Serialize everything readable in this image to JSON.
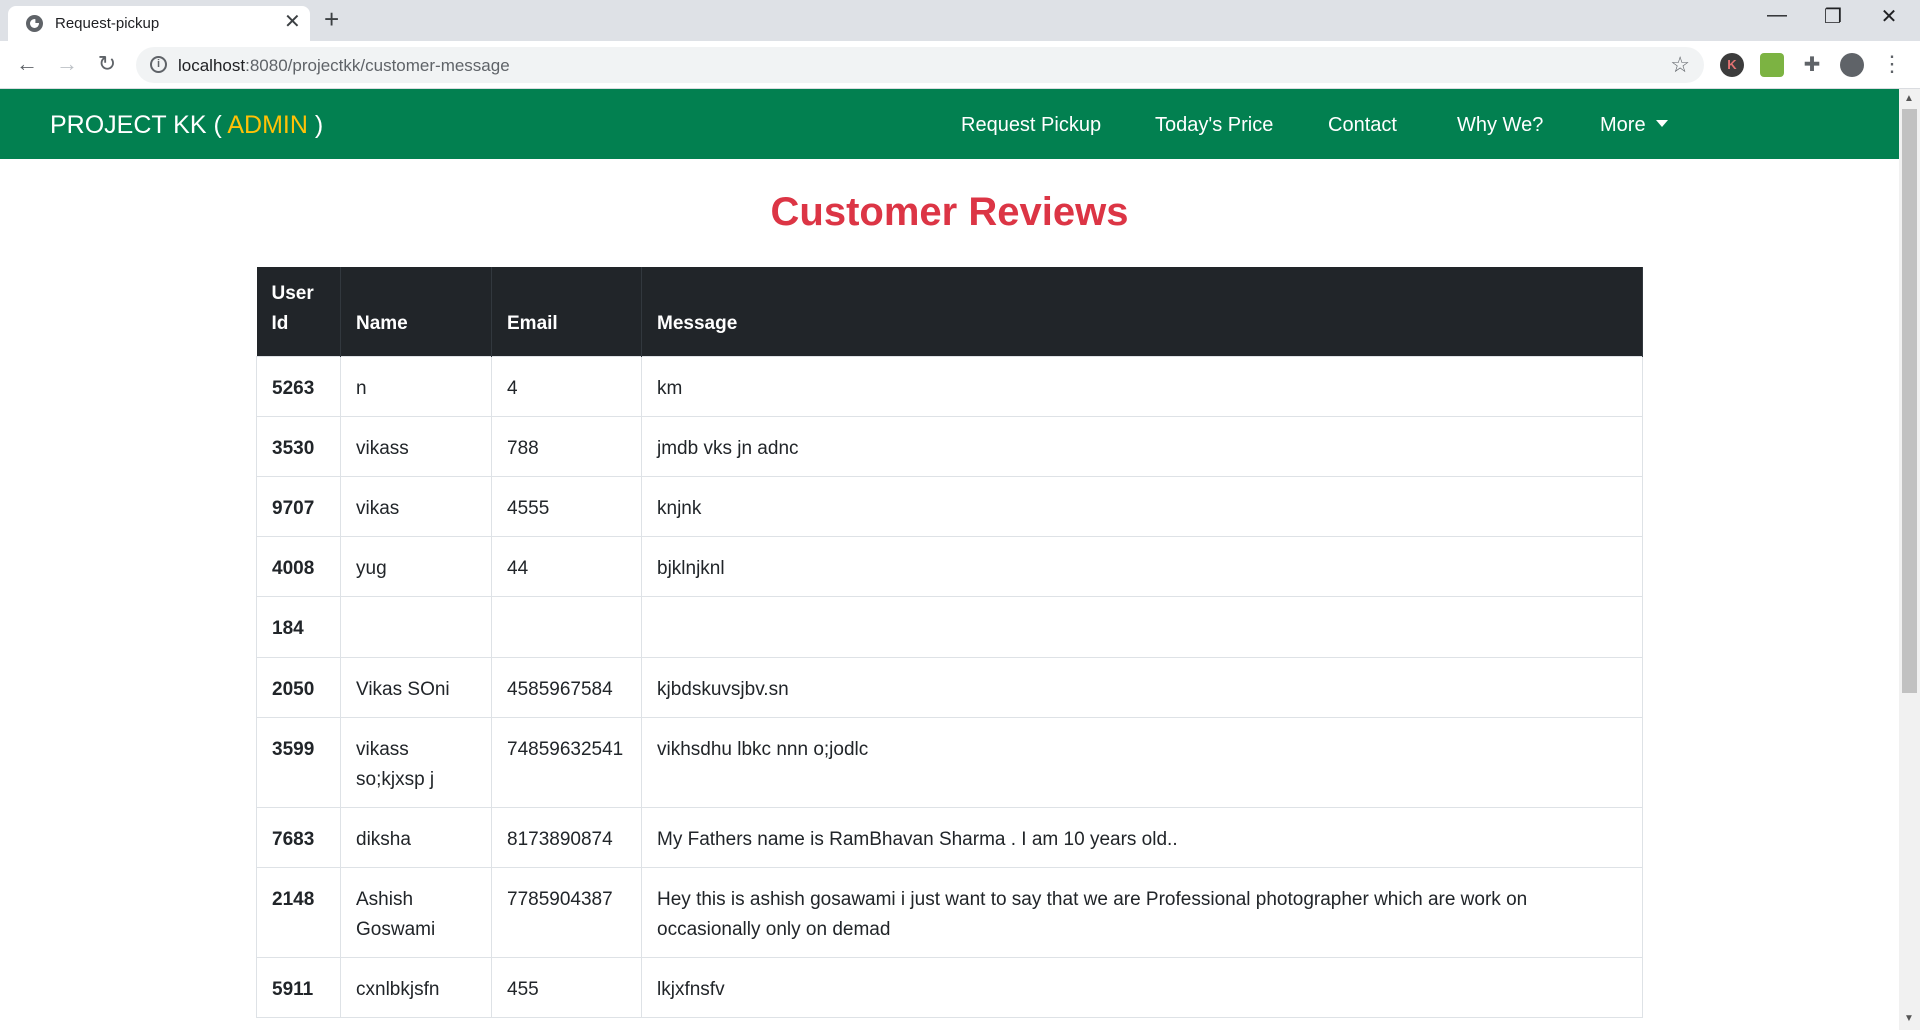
{
  "browser": {
    "tab_title": "Request-pickup",
    "tab_close": "✕",
    "new_tab": "+",
    "url_host": "localhost",
    "url_path": ":8080/projectkk/customer-message",
    "minimize": "—",
    "restore": "❐",
    "close": "✕",
    "ext_k_label": "K"
  },
  "navbar": {
    "brand_prefix": "PROJECT KK ( ",
    "brand_admin": "ADMIN",
    "brand_suffix": " )",
    "links": [
      "Request Pickup",
      "Today's Price",
      "Contact",
      "Why We?",
      "More"
    ],
    "colors": {
      "bar": "#028050",
      "admin": "#ffc107"
    }
  },
  "page": {
    "title": "Customer Reviews",
    "title_color": "#dc3545"
  },
  "table": {
    "headers": [
      "User Id",
      "Name",
      "Email",
      "Message"
    ],
    "rows": [
      {
        "id": "5263",
        "name": "n",
        "email": "4",
        "message": "km"
      },
      {
        "id": "3530",
        "name": "vikass",
        "email": "788",
        "message": "jmdb vks jn adnc"
      },
      {
        "id": "9707",
        "name": "vikas",
        "email": "4555",
        "message": "knjnk"
      },
      {
        "id": "4008",
        "name": "yug",
        "email": "44",
        "message": "bjklnjknl"
      },
      {
        "id": "184",
        "name": "",
        "email": "",
        "message": ""
      },
      {
        "id": "2050",
        "name": "Vikas SOni",
        "email": "4585967584",
        "message": "kjbdskuvsjbv.sn"
      },
      {
        "id": "3599",
        "name": "vikass so;kjxsp j",
        "email": "74859632541",
        "message": "vikhsdhu lbkc nnn o;jodlc"
      },
      {
        "id": "7683",
        "name": "diksha",
        "email": "8173890874",
        "message": "My Fathers name is RamBhavan Sharma . I am 10 years old.."
      },
      {
        "id": "2148",
        "name": "Ashish Goswami",
        "email": "7785904387",
        "message": "Hey this is ashish gosawami i just want to say that we are Professional photographer which are work on occasionally only on demad"
      },
      {
        "id": "5911",
        "name": "cxnlbkjsfn",
        "email": "455",
        "message": "lkjxfnsfv"
      }
    ]
  }
}
